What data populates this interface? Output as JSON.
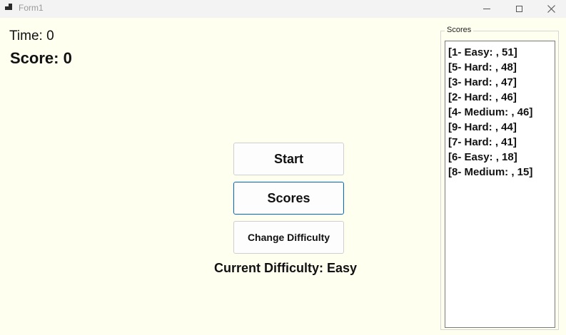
{
  "window": {
    "title": "Form1"
  },
  "game": {
    "time_text": "Time: 0",
    "score_text": "Score: 0",
    "current_difficulty_text": "Current Difficulty: Easy"
  },
  "buttons": {
    "start": "Start",
    "scores": "Scores",
    "change_difficulty": "Change Difficulty"
  },
  "scores_panel": {
    "title": "Scores",
    "items": [
      "[1- Easy: , 51]",
      "[5- Hard: , 48]",
      "[3- Hard: , 47]",
      "[2- Hard: , 46]",
      "[4- Medium: , 46]",
      "[9- Hard: , 44]",
      "[7- Hard: , 41]",
      "[6- Easy: , 18]",
      "[8- Medium: , 15]"
    ]
  }
}
